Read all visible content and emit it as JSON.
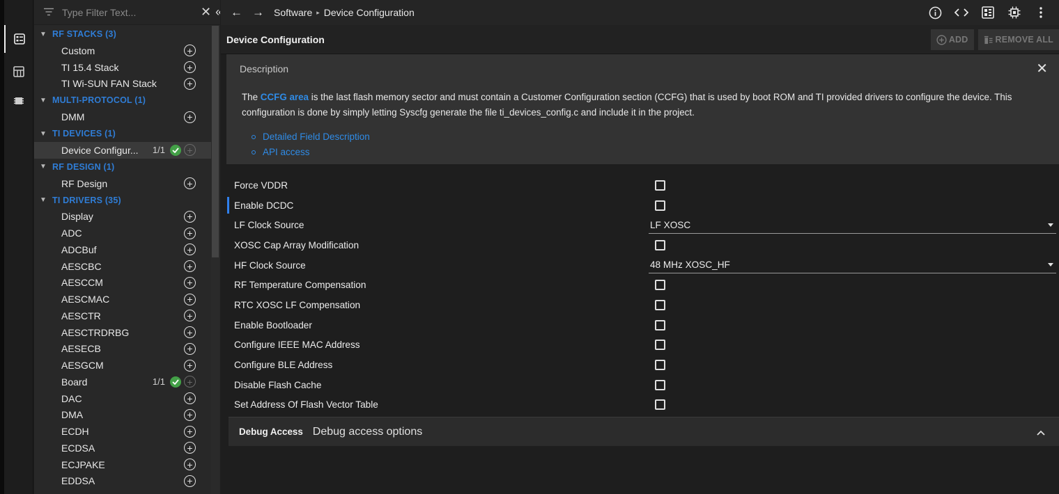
{
  "sidebar": {
    "filter_placeholder": "Type Filter Text...",
    "clear_label": "✕",
    "collapse_label": "«",
    "categories": [
      {
        "label": "RF STACKS (3)"
      },
      {
        "label": "MULTI-PROTOCOL (1)"
      },
      {
        "label": "TI DEVICES (1)"
      },
      {
        "label": "RF DESIGN (1)"
      },
      {
        "label": "TI DRIVERS (35)"
      }
    ],
    "items": [
      {
        "label": "Custom"
      },
      {
        "label": "TI 15.4 Stack"
      },
      {
        "label": "TI Wi-SUN FAN Stack"
      },
      {
        "label": "DMM"
      },
      {
        "label": "Device Configur...",
        "count": "1/1"
      },
      {
        "label": "RF Design"
      },
      {
        "label": "Display"
      },
      {
        "label": "ADC"
      },
      {
        "label": "ADCBuf"
      },
      {
        "label": "AESCBC"
      },
      {
        "label": "AESCCM"
      },
      {
        "label": "AESCMAC"
      },
      {
        "label": "AESCTR"
      },
      {
        "label": "AESCTRDRBG"
      },
      {
        "label": "AESECB"
      },
      {
        "label": "AESGCM"
      },
      {
        "label": "Board",
        "count": "1/1"
      },
      {
        "label": "DAC"
      },
      {
        "label": "DMA"
      },
      {
        "label": "ECDH"
      },
      {
        "label": "ECDSA"
      },
      {
        "label": "ECJPAKE"
      },
      {
        "label": "EDDSA"
      }
    ]
  },
  "topbar": {
    "breadcrumb": [
      "Software",
      "Device Configuration"
    ],
    "separator": "▸"
  },
  "config": {
    "title": "Device Configuration",
    "add_label": "ADD",
    "remove_all_label": "REMOVE ALL"
  },
  "description": {
    "title": "Description",
    "text_pre": "The ",
    "text_link": "CCFG area",
    "text_post": " is the last flash memory sector and must contain a Customer Configuration section (CCFG) that is used by boot ROM and TI provided drivers to configure the device. This configuration is done by simply letting Syscfg generate the file ti_devices_config.c and include it in the project.",
    "links": [
      "Detailed Field Description",
      "API access"
    ]
  },
  "rows": [
    {
      "label": "Force VDDR",
      "type": "checkbox",
      "checked": false
    },
    {
      "label": "Enable DCDC",
      "type": "checkbox",
      "checked": false
    },
    {
      "label": "LF Clock Source",
      "type": "select",
      "value": "LF XOSC"
    },
    {
      "label": "XOSC Cap Array Modification",
      "type": "checkbox",
      "checked": false
    },
    {
      "label": "HF Clock Source",
      "type": "select",
      "value": "48 MHz XOSC_HF"
    },
    {
      "label": "RF Temperature Compensation",
      "type": "checkbox",
      "checked": false
    },
    {
      "label": "RTC XOSC LF Compensation",
      "type": "checkbox",
      "checked": false
    },
    {
      "label": "Enable Bootloader",
      "type": "checkbox",
      "checked": false
    },
    {
      "label": "Configure IEEE MAC Address",
      "type": "checkbox",
      "checked": false
    },
    {
      "label": "Configure BLE Address",
      "type": "checkbox",
      "checked": false
    },
    {
      "label": "Disable Flash Cache",
      "type": "checkbox",
      "checked": false
    },
    {
      "label": "Set Address Of Flash Vector Table",
      "type": "checkbox",
      "checked": false
    }
  ],
  "debug": {
    "title": "Debug Access",
    "desc": "Debug access options"
  },
  "colors": {
    "accent": "#2f80ed",
    "link": "#2f8be6",
    "check_green": "#43a047",
    "background": "#1e1e1e"
  }
}
